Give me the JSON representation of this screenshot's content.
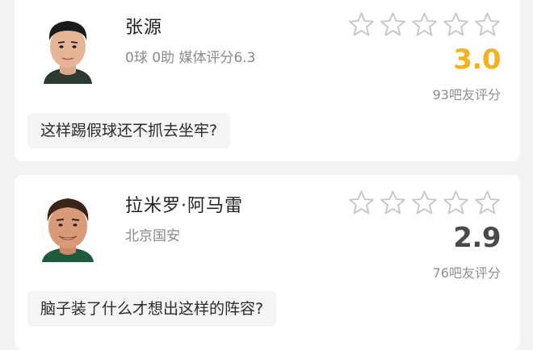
{
  "cards": [
    {
      "name": "张源",
      "subtitle": "0球 0助  媒体评分6.3",
      "stars": 5,
      "score": "3.0",
      "rating_count": "93吧友评分",
      "comment": "这样踢假球还不抓去坐牢?",
      "score_color": "#f3b31e"
    },
    {
      "name": "拉米罗·阿马雷",
      "subtitle": "北京国安",
      "stars": 5,
      "score": "2.9",
      "rating_count": "76吧友评分",
      "comment": "脑子装了什么才想出这样的阵容?",
      "score_color": "#4a4a4a"
    }
  ],
  "icons": {
    "star": "star-outline-icon",
    "avatar": "player-avatar"
  }
}
